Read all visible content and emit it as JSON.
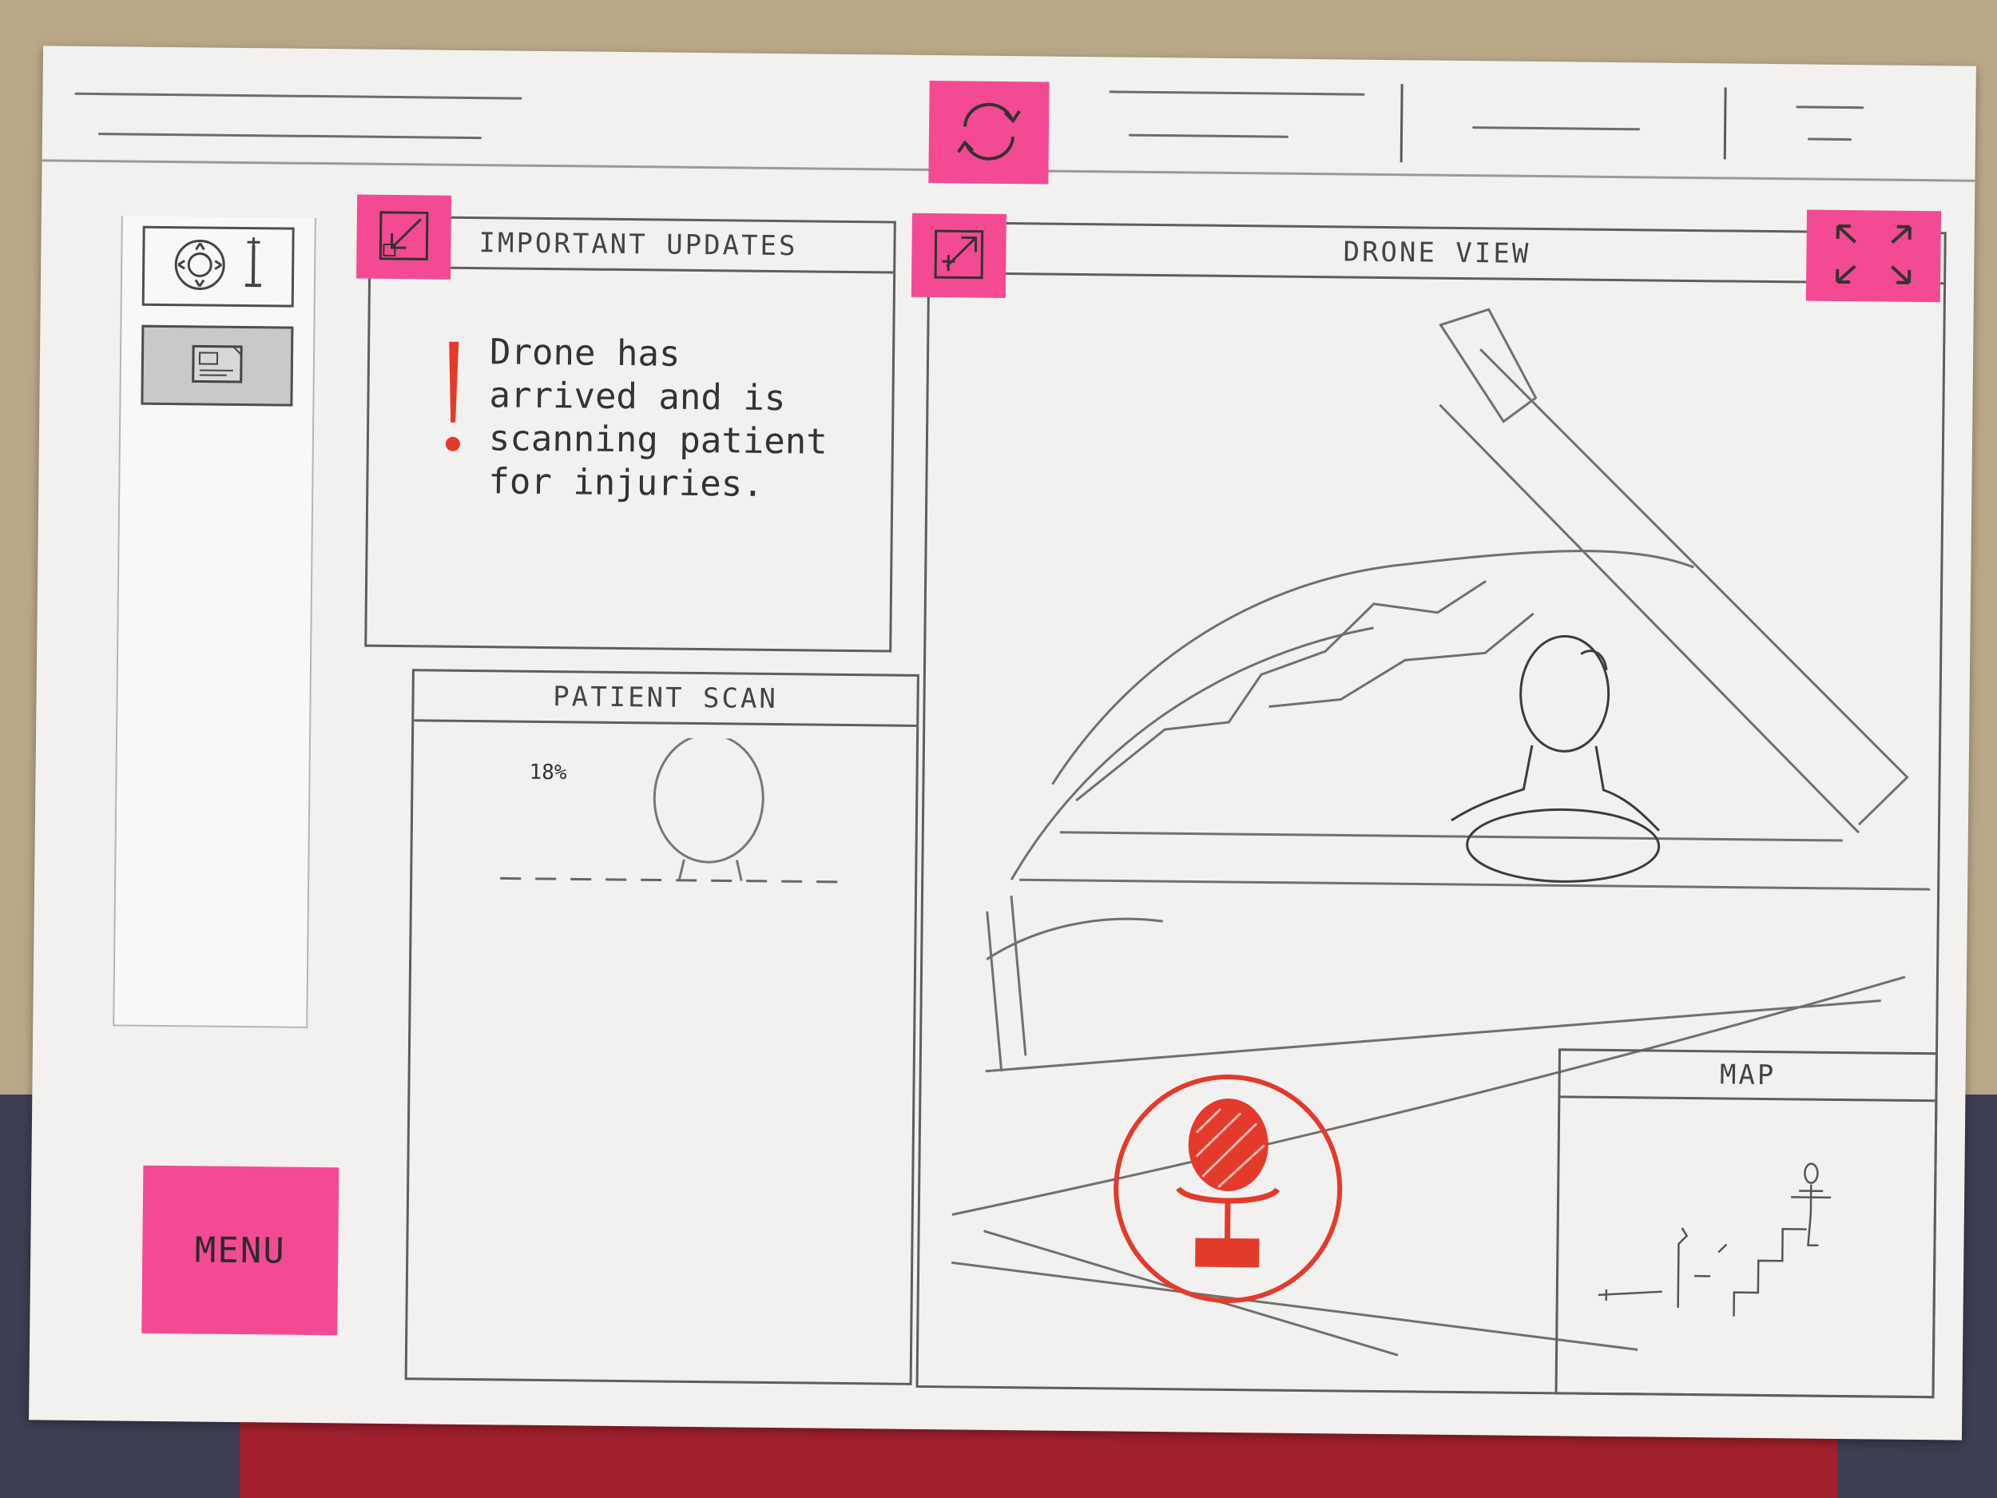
{
  "toolbar": {
    "refresh_icon": "refresh-icon"
  },
  "sidebar": {
    "items": [
      {
        "icon": "drone-control-icon"
      },
      {
        "icon": "document-icon"
      }
    ],
    "menu_label": "MENU"
  },
  "updates": {
    "title": "IMPORTANT UPDATES",
    "alert_icon": "exclamation-icon",
    "message": "Drone has\narrived and is\nscanning patient\nfor injuries."
  },
  "scan": {
    "title": "PATIENT SCAN",
    "progress_text": "18%",
    "progress": 18
  },
  "drone": {
    "title": "DRONE VIEW",
    "mic_icon": "microphone-icon"
  },
  "map": {
    "title": "MAP"
  },
  "colors": {
    "sticky_note": "#f44a93",
    "mic_red": "#e43a2c",
    "pencil": "#5e5e5e"
  }
}
